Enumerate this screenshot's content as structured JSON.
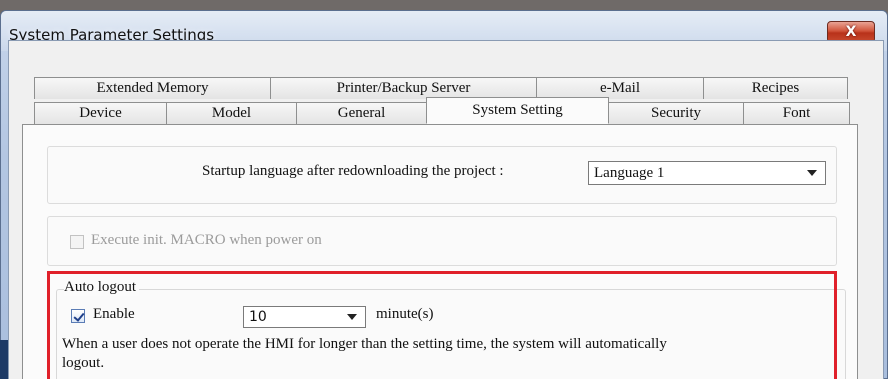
{
  "window": {
    "title": "System Parameter Settings",
    "close_label": "X"
  },
  "tabs": {
    "row1": [
      "Extended Memory",
      "Printer/Backup Server",
      "e-Mail",
      "Recipes"
    ],
    "row2": [
      "Device",
      "Model",
      "General",
      "System Setting",
      "Security",
      "Font"
    ],
    "active": "System Setting"
  },
  "startup": {
    "label": "Startup language after redownloading the project :",
    "selected": "Language 1"
  },
  "macro": {
    "label": "Execute init. MACRO when power on",
    "checked": false,
    "disabled": true
  },
  "auto_logout": {
    "group_title": "Auto logout",
    "enable_label": "Enable",
    "enable_checked": true,
    "minutes_value": "10",
    "minutes_unit": "minute(s)",
    "description_line1": "When a user does not operate the HMI for longer than the setting time, the system will automatically",
    "description_line2": "logout."
  },
  "colors": {
    "highlight_border": "#e0202a",
    "title_bar": "#b3c6e2"
  }
}
